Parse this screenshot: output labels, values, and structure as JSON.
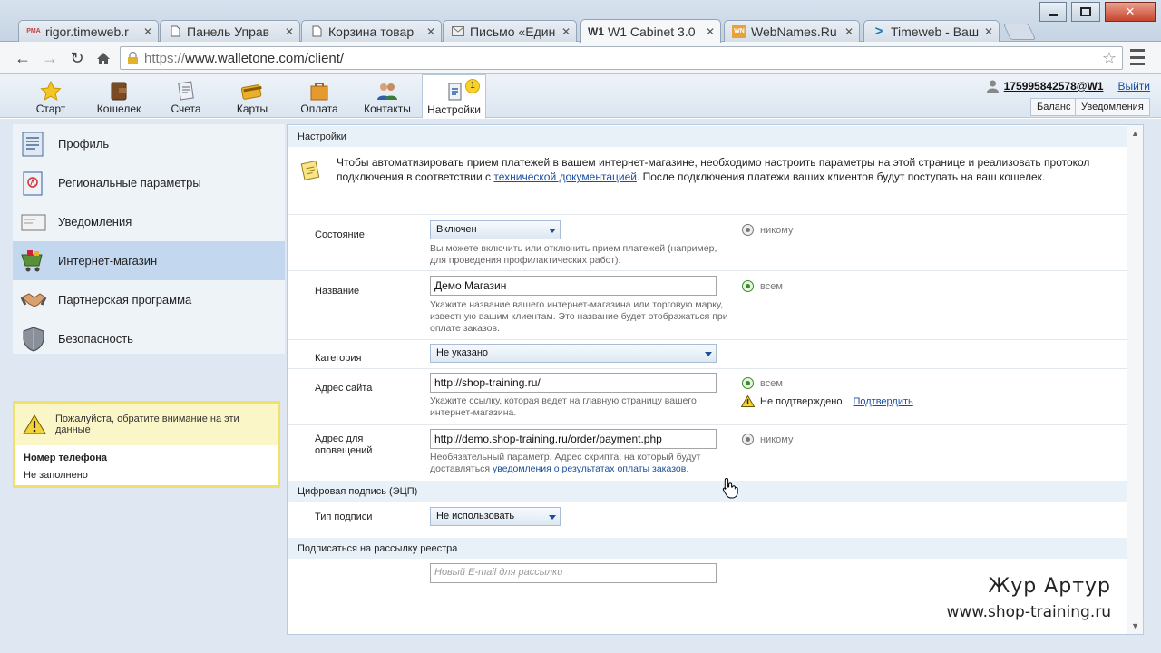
{
  "browser": {
    "tabs": [
      {
        "title": "rigor.timeweb.r",
        "fav": "РМА",
        "active": false
      },
      {
        "title": "Панель Управ",
        "fav": "doc",
        "active": false
      },
      {
        "title": "Корзина товар",
        "fav": "doc",
        "active": false
      },
      {
        "title": "Письмо «Един",
        "fav": "mail",
        "active": false
      },
      {
        "title": "W1 Cabinet 3.0",
        "fav": "W1",
        "active": true
      },
      {
        "title": "WebNames.Ru",
        "fav": "WN",
        "active": false
      },
      {
        "title": "Timeweb - Ваш",
        "fav": ">",
        "active": false
      }
    ],
    "url_scheme": "https://",
    "url_rest": "www.walletone.com/client/"
  },
  "nav": {
    "items": [
      {
        "label": "Старт",
        "icon": "star-icon"
      },
      {
        "label": "Кошелек",
        "icon": "wallet-icon"
      },
      {
        "label": "Счета",
        "icon": "invoices-icon"
      },
      {
        "label": "Карты",
        "icon": "cards-icon"
      },
      {
        "label": "Оплата",
        "icon": "payment-icon"
      },
      {
        "label": "Контакты",
        "icon": "contacts-icon"
      },
      {
        "label": "Настройки",
        "icon": "settings-icon"
      }
    ],
    "settings_badge": "1"
  },
  "user": {
    "id": "175995842578@W1",
    "logout": "Выйти",
    "balance_btn": "Баланс",
    "notifications_btn": "Уведомления"
  },
  "sidebar": {
    "items": [
      {
        "label": "Профиль",
        "icon": "profile-icon",
        "active": false
      },
      {
        "label": "Региональные параметры",
        "icon": "regional-icon",
        "active": false
      },
      {
        "label": "Уведомления",
        "icon": "notifications-icon",
        "active": false
      },
      {
        "label": "Интернет-магазин",
        "icon": "shop-icon",
        "active": true
      },
      {
        "label": "Партнерская программа",
        "icon": "handshake-icon",
        "active": false
      },
      {
        "label": "Безопасность",
        "icon": "shield-icon",
        "active": false
      }
    ]
  },
  "notice": {
    "text": "Пожалуйста, обратите внимание на эти данные",
    "field_title": "Номер телефона",
    "field_value": "Не заполнено"
  },
  "settings": {
    "section_title": "Настройки",
    "intro_before": "Чтобы автоматизировать прием платежей в вашем интернет-магазине, необходимо настроить параметры на этой странице и реализовать протокол подключения в соответствии с ",
    "intro_link": "технической документацией",
    "intro_after": ". После подключения платежи ваших клиентов будут поступать на ваш кошелек.",
    "state": {
      "label": "Состояние",
      "value": "Включен",
      "hint": "Вы можете включить или отключить прием платежей (например, для проведения профилактических работ).",
      "visibility": "никому"
    },
    "name": {
      "label": "Название",
      "value": "Демо Магазин",
      "hint": "Укажите название вашего интернет-магазина или торговую марку, известную вашим клиентам. Это название будет отображаться при оплате заказов.",
      "visibility": "всем"
    },
    "category": {
      "label": "Категория",
      "value": "Не указано"
    },
    "site": {
      "label": "Адрес сайта",
      "value": "http://shop-training.ru/",
      "hint": "Укажите ссылку, которая ведет на главную страницу вашего интернет-магазина.",
      "visibility": "всем",
      "status": "Не подтверждено",
      "confirm": "Подтвердить"
    },
    "notify": {
      "label": "Адрес для оповещений",
      "value": "http://demo.shop-training.ru/order/payment.php",
      "hint_before": "Необязательный параметр. Адрес скрипта, на который будут доставляться ",
      "hint_link": "уведомления о результатах оплаты заказов",
      "hint_after": ".",
      "visibility": "никому"
    }
  },
  "signature": {
    "section_title": "Цифровая подпись (ЭЦП)",
    "type_label": "Тип подписи",
    "type_value": "Не использовать"
  },
  "subscribe": {
    "section_title": "Подписаться на рассылку реестра",
    "placeholder": "Новый E-mail для рассылки"
  },
  "watermark": {
    "name": "Жур Артур",
    "site": "www.shop-training.ru"
  },
  "colors": {
    "accent": "#1a4e9e",
    "active_side": "#c3d8ef",
    "notice_border": "#f0e16a"
  }
}
